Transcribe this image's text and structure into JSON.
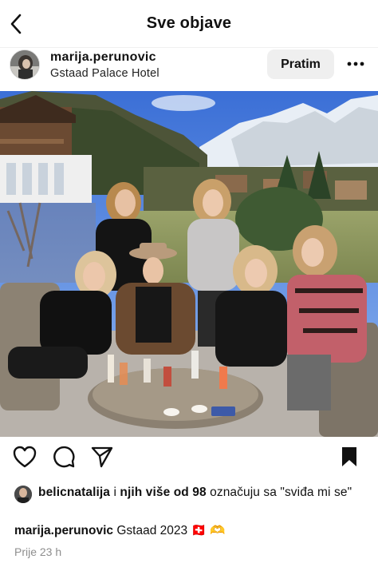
{
  "header": {
    "title": "Sve objave"
  },
  "post": {
    "username": "marija.perunovic",
    "location": "Gstaad Palace Hotel",
    "follow_label": "Pratim"
  },
  "likes": {
    "liker": "belicnatalija",
    "middle": " i ",
    "others": "njih više od 98",
    "suffix": " označuju sa \"sviđa mi se\""
  },
  "caption": {
    "username": "marija.perunovic",
    "text": "Gstaad 2023",
    "emojis": "🇨🇭 🫶"
  },
  "timestamp": "Prije 23 h",
  "icons": [
    "back-icon",
    "more-icon",
    "heart-icon",
    "comment-icon",
    "share-icon",
    "bookmark-icon"
  ]
}
